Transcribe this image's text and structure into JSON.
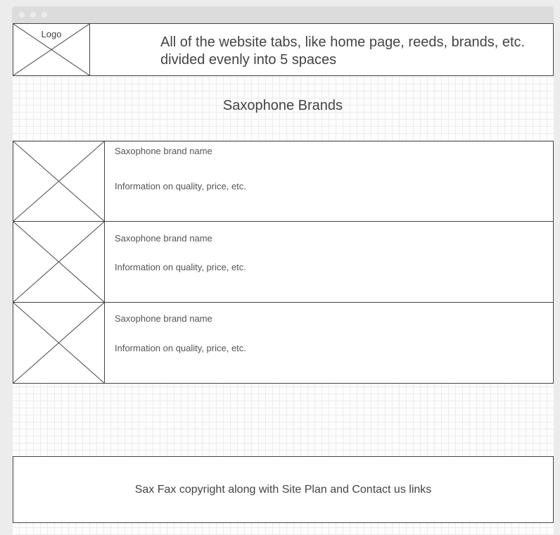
{
  "header": {
    "logo_label": "Logo",
    "nav_description": "All of the website tabs, like home page, reeds, brands, etc. divided evenly into 5 spaces"
  },
  "main": {
    "title": "Saxophone Brands",
    "brands": [
      {
        "name": "Saxophone brand name",
        "info": "Information on quality, price, etc."
      },
      {
        "name": "Saxophone brand name",
        "info": "Information on quality, price, etc."
      },
      {
        "name": "Saxophone brand name",
        "info": "Information on quality, price, etc."
      }
    ]
  },
  "footer": {
    "text": "Sax Fax copyright along with Site Plan and Contact us links"
  },
  "colors": {
    "line": "#444444",
    "grid": "#ececec",
    "titlebar": "#dcdcdc"
  }
}
